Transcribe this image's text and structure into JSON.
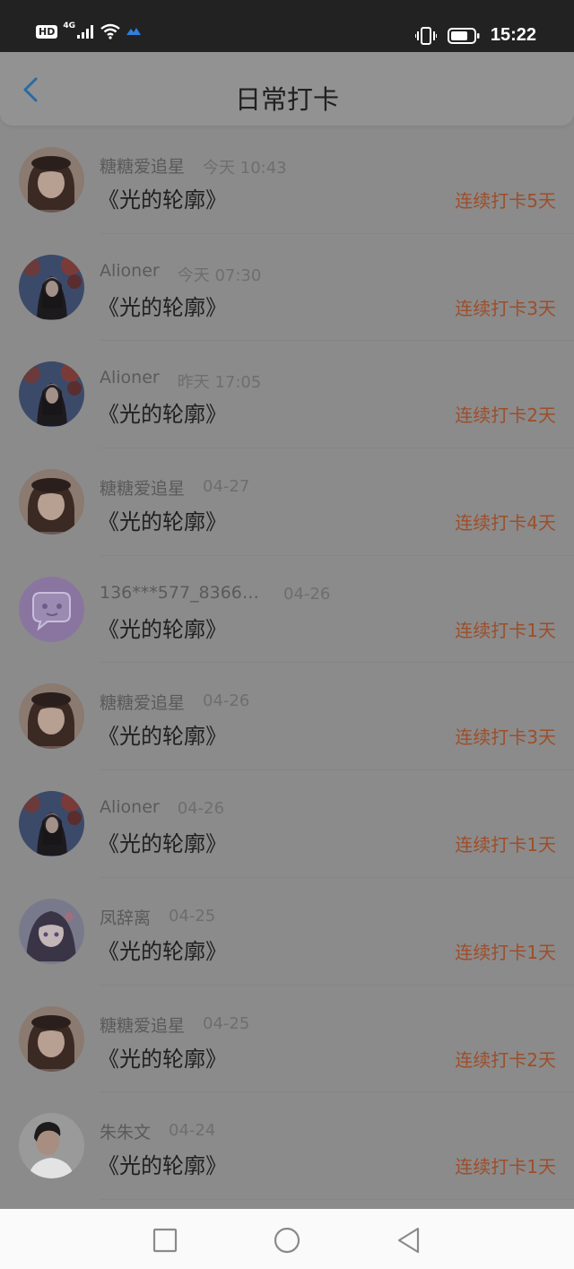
{
  "status_bar": {
    "time": "15:22",
    "network_label": "HD",
    "network_type": "4G",
    "battery_percent": 0.75
  },
  "header": {
    "title": "日常打卡",
    "back_icon": "chevron-left-icon"
  },
  "items": [
    {
      "name": "糖糖爱追星",
      "date": "今天 10:43",
      "book": "《光的轮廓》",
      "streak": "连续打卡5天",
      "avatar": "girl-beret"
    },
    {
      "name": "Alioner",
      "date": "今天 07:30",
      "book": "《光的轮廓》",
      "streak": "连续打卡3天",
      "avatar": "girl-tree"
    },
    {
      "name": "Alioner",
      "date": "昨天 17:05",
      "book": "《光的轮廓》",
      "streak": "连续打卡2天",
      "avatar": "girl-tree"
    },
    {
      "name": "糖糖爱追星",
      "date": "04-27",
      "book": "《光的轮廓》",
      "streak": "连续打卡4天",
      "avatar": "girl-beret"
    },
    {
      "name": "136***577_83667...",
      "date": "04-26",
      "book": "《光的轮廓》",
      "streak": "连续打卡1天",
      "avatar": "default-chat"
    },
    {
      "name": "糖糖爱追星",
      "date": "04-26",
      "book": "《光的轮廓》",
      "streak": "连续打卡3天",
      "avatar": "girl-beret"
    },
    {
      "name": "Alioner",
      "date": "04-26",
      "book": "《光的轮廓》",
      "streak": "连续打卡1天",
      "avatar": "girl-tree"
    },
    {
      "name": "凤辞离",
      "date": "04-25",
      "book": "《光的轮廓》",
      "streak": "连续打卡1天",
      "avatar": "anime-girl"
    },
    {
      "name": "糖糖爱追星",
      "date": "04-25",
      "book": "《光的轮廓》",
      "streak": "连续打卡2天",
      "avatar": "girl-beret"
    },
    {
      "name": "朱朱文",
      "date": "04-24",
      "book": "《光的轮廓》",
      "streak": "连续打卡1天",
      "avatar": "boy-portrait"
    }
  ],
  "nav": {
    "recent_icon": "square-icon",
    "home_icon": "circle-icon",
    "back_icon": "triangle-back-icon"
  },
  "colors": {
    "streak": "#9d4e2a",
    "back_arrow": "#2a6aa3",
    "dim_overlay": "#8b8b8b"
  }
}
